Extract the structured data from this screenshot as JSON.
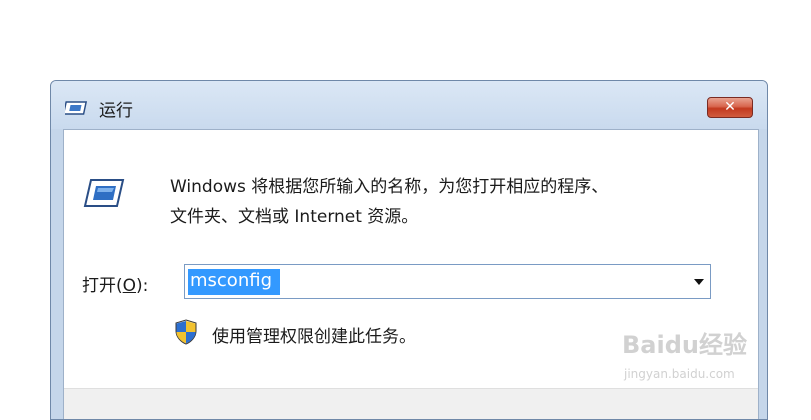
{
  "window": {
    "title": "运行",
    "close_label": "✕"
  },
  "content": {
    "description_line1": "Windows 将根据您所输入的名称，为您打开相应的程序、",
    "description_line2": "文件夹、文档或 Internet 资源。",
    "open_label_prefix": "打开(",
    "open_label_key": "O",
    "open_label_suffix": "):",
    "input_value": "msconfig",
    "admin_note": "使用管理权限创建此任务。"
  },
  "watermark": {
    "brand": "Baidu经验",
    "url": "jingyan.baidu.com"
  },
  "colors": {
    "title_bg": "#c9daee",
    "close_red": "#c2391f",
    "selection": "#3399ff"
  },
  "icons": [
    "run-icon",
    "close-icon",
    "run-large-icon",
    "chevron-down-icon",
    "uac-shield-icon"
  ]
}
